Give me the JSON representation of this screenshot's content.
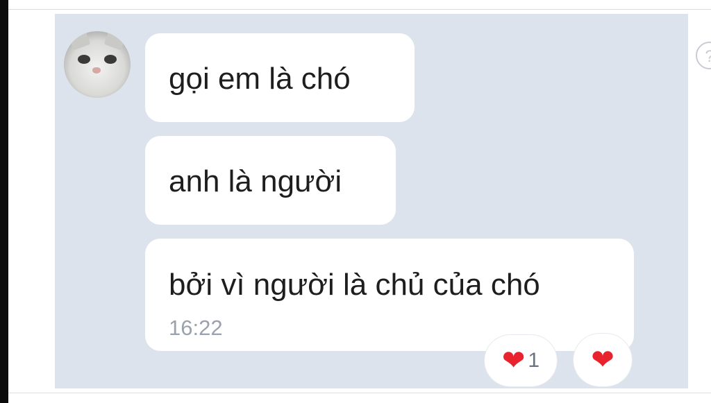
{
  "messages": [
    {
      "text": "gọi em là chó"
    },
    {
      "text": "anh là người"
    },
    {
      "text": "bởi vì người là chủ của chó",
      "time": "16:22"
    }
  ],
  "reactions": [
    {
      "icon": "heart-icon",
      "count": "1"
    },
    {
      "icon": "heart-icon"
    }
  ],
  "icons": {
    "heart": "❤",
    "side": "?"
  },
  "colors": {
    "chat_background": "#dde3ec",
    "bubble": "#ffffff",
    "heart": "#e8232e",
    "timestamp": "#9aa2ad"
  }
}
